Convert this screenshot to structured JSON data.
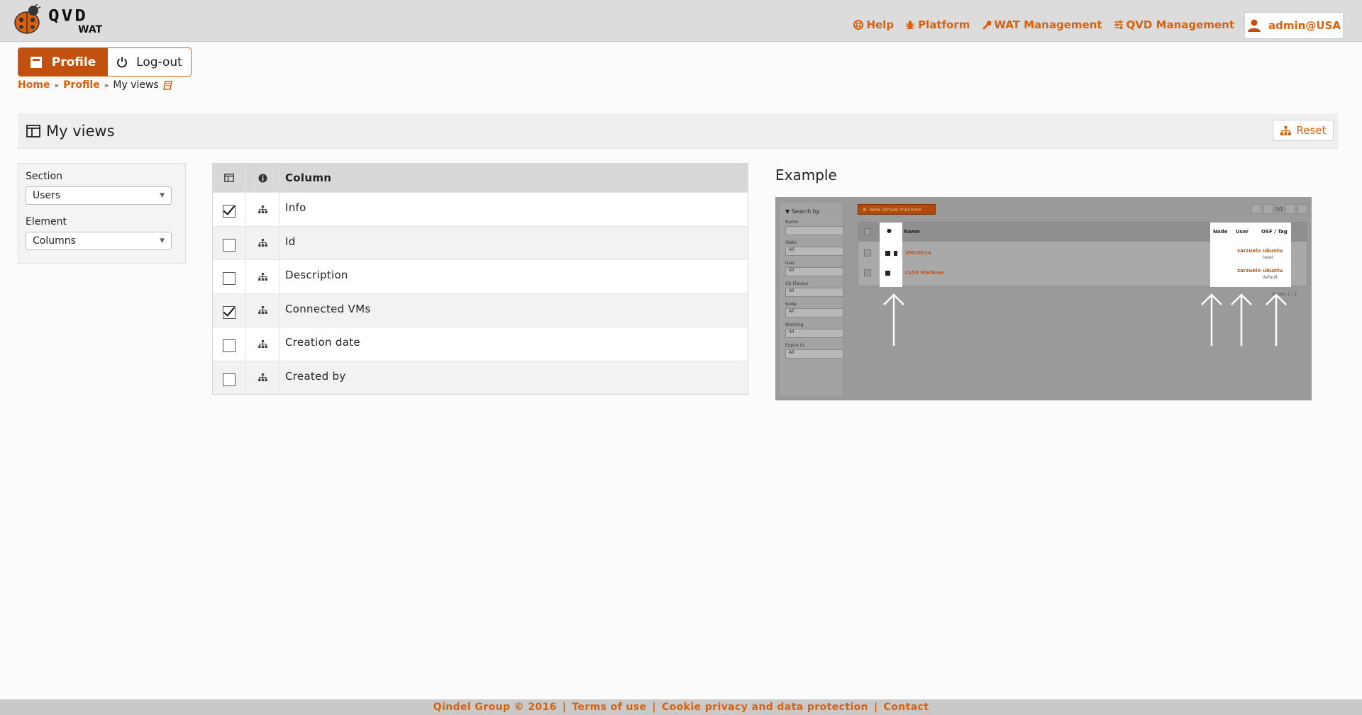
{
  "app": {
    "logo_text": "QVD",
    "logo_sub": "WAT"
  },
  "topnav": {
    "help": "Help",
    "platform": "Platform",
    "wat_management": "WAT Management",
    "qvd_management": "QVD Management",
    "user": "admin@USA"
  },
  "actions": {
    "profile": "Profile",
    "logout": "Log-out"
  },
  "breadcrumb": {
    "home": "Home",
    "profile": "Profile",
    "current": "My views"
  },
  "page": {
    "title": "My views",
    "reset": "Reset"
  },
  "filter": {
    "section_label": "Section",
    "section_value": "Users",
    "element_label": "Element",
    "element_value": "Columns"
  },
  "columns": {
    "header": "Column",
    "rows": [
      {
        "label": "Info",
        "checked": true
      },
      {
        "label": "Id",
        "checked": false
      },
      {
        "label": "Description",
        "checked": false
      },
      {
        "label": "Connected VMs",
        "checked": true
      },
      {
        "label": "Creation date",
        "checked": false
      },
      {
        "label": "Created by",
        "checked": false
      }
    ]
  },
  "example": {
    "label": "Example",
    "search_by": "Search by",
    "filters": [
      "Name",
      "State",
      "User",
      "OS Flavour",
      "Node",
      "Blocking",
      "Expire in"
    ],
    "all": "All",
    "new_vm": "New Virtual machine",
    "pager": "1/1",
    "cols": {
      "name": "Name",
      "node": "Node",
      "user": "User",
      "osf": "OSF / Tag"
    },
    "rows": [
      {
        "name": "VM20014",
        "user": "zarzuelo",
        "osf": "ubuntu",
        "tag": "head"
      },
      {
        "name": "Cs58 Machine",
        "user": "zarzuelo",
        "osf": "ubuntu",
        "tag": "default"
      }
    ],
    "shown": "Shown 2 / 2"
  },
  "footer": {
    "copyright": "Qindel Group © 2016",
    "terms": "Terms of use",
    "cookie": "Cookie privacy and data protection",
    "contact": "Contact"
  },
  "colors": {
    "accent": "#d9610e",
    "accent_dark": "#c2500f",
    "topbar": "#dcdcdc"
  }
}
